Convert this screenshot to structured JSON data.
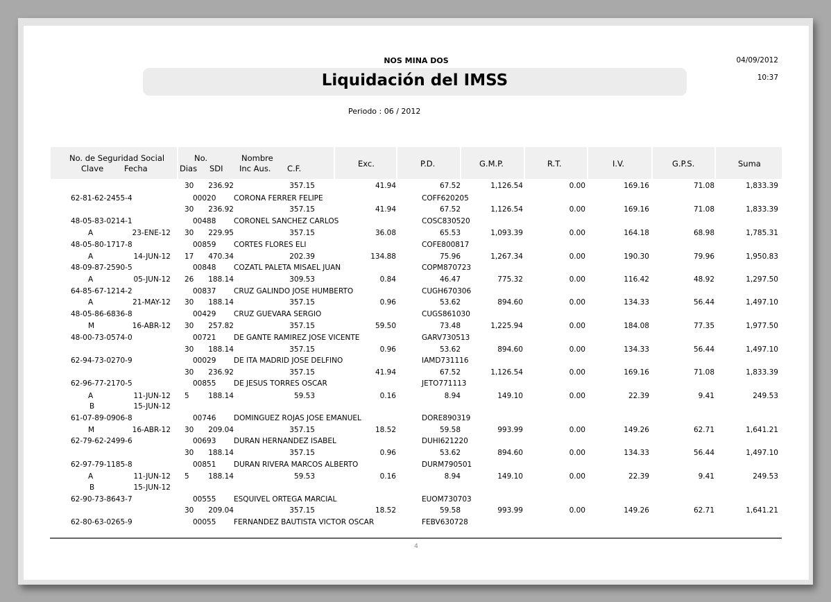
{
  "company": "NOS MINA DOS",
  "title": "Liquidación del IMSS",
  "date": "04/09/2012",
  "time": "10:37",
  "periodo": "Periodo :  06 / 2012",
  "headers": {
    "nss": "No. de Seguridad Social",
    "clave": "Clave",
    "fecha": "Fecha",
    "no": "No.",
    "dias": "Dias",
    "sdi": "SDI",
    "nombre": "Nombre",
    "inc_aus": "Inc Aus.",
    "cf": "C.F.",
    "exc": "Exc.",
    "pd": "P.D.",
    "gmp": "G.M.P.",
    "rt": "R.T.",
    "iv": "I.V.",
    "gps": "G.P.S.",
    "suma": "Suma"
  },
  "rows": [
    {
      "type": "amount",
      "clave": "",
      "fecha": "",
      "dias": "30",
      "sdi": "236.92",
      "cf": "357.15",
      "exc": "41.94",
      "pd": "67.52",
      "gmp": "1,126.54",
      "rt": "0.00",
      "iv": "169.16",
      "gps": "71.08",
      "suma": "1,833.39"
    },
    {
      "type": "emp",
      "nss": "62-81-62-2455-4",
      "no": "00020",
      "nombre": "CORONA FERRER FELIPE",
      "rfc": "COFF620205"
    },
    {
      "type": "amount",
      "clave": "",
      "fecha": "",
      "dias": "30",
      "sdi": "236.92",
      "cf": "357.15",
      "exc": "41.94",
      "pd": "67.52",
      "gmp": "1,126.54",
      "rt": "0.00",
      "iv": "169.16",
      "gps": "71.08",
      "suma": "1,833.39"
    },
    {
      "type": "emp",
      "nss": "48-05-83-0214-1",
      "no": "00488",
      "nombre": "CORONEL SANCHEZ CARLOS",
      "rfc": "COSC830520"
    },
    {
      "type": "amount",
      "clave": "A",
      "fecha": "23-ENE-12",
      "dias": "30",
      "sdi": "229.95",
      "cf": "357.15",
      "exc": "36.08",
      "pd": "65.53",
      "gmp": "1,093.39",
      "rt": "0.00",
      "iv": "164.18",
      "gps": "68.98",
      "suma": "1,785.31"
    },
    {
      "type": "emp",
      "nss": "48-05-80-1717-8",
      "no": "00859",
      "nombre": "CORTES FLORES ELI",
      "rfc": "COFE800817"
    },
    {
      "type": "amount",
      "clave": "A",
      "fecha": "14-JUN-12",
      "dias": "17",
      "sdi": "470.34",
      "cf": "202.39",
      "exc": "134.88",
      "pd": "75.96",
      "gmp": "1,267.34",
      "rt": "0.00",
      "iv": "190.30",
      "gps": "79.96",
      "suma": "1,950.83"
    },
    {
      "type": "emp",
      "nss": "48-09-87-2590-5",
      "no": "00848",
      "nombre": "COZATL PALETA MISAEL JUAN",
      "rfc": "COPM870723"
    },
    {
      "type": "amount",
      "clave": "A",
      "fecha": "05-JUN-12",
      "dias": "26",
      "sdi": "188.14",
      "cf": "309.53",
      "exc": "0.84",
      "pd": "46.47",
      "gmp": "775.32",
      "rt": "0.00",
      "iv": "116.42",
      "gps": "48.92",
      "suma": "1,297.50"
    },
    {
      "type": "emp",
      "nss": "64-85-67-1214-2",
      "no": "00837",
      "nombre": "CRUZ GALINDO JOSE HUMBERTO",
      "rfc": "CUGH670306"
    },
    {
      "type": "amount",
      "clave": "A",
      "fecha": "21-MAY-12",
      "dias": "30",
      "sdi": "188.14",
      "cf": "357.15",
      "exc": "0.96",
      "pd": "53.62",
      "gmp": "894.60",
      "rt": "0.00",
      "iv": "134.33",
      "gps": "56.44",
      "suma": "1,497.10"
    },
    {
      "type": "emp",
      "nss": "48-05-86-6836-8",
      "no": "00429",
      "nombre": "CRUZ GUEVARA SERGIO",
      "rfc": "CUGS861030"
    },
    {
      "type": "amount",
      "clave": "M",
      "fecha": "16-ABR-12",
      "dias": "30",
      "sdi": "257.82",
      "cf": "357.15",
      "exc": "59.50",
      "pd": "73.48",
      "gmp": "1,225.94",
      "rt": "0.00",
      "iv": "184.08",
      "gps": "77.35",
      "suma": "1,977.50"
    },
    {
      "type": "emp",
      "nss": "48-00-73-0574-0",
      "no": "00721",
      "nombre": "DE GANTE RAMIREZ JOSE VICENTE",
      "rfc": "GARV730513"
    },
    {
      "type": "amount",
      "clave": "",
      "fecha": "",
      "dias": "30",
      "sdi": "188.14",
      "cf": "357.15",
      "exc": "0.96",
      "pd": "53.62",
      "gmp": "894.60",
      "rt": "0.00",
      "iv": "134.33",
      "gps": "56.44",
      "suma": "1,497.10"
    },
    {
      "type": "emp",
      "nss": "62-94-73-0270-9",
      "no": "00029",
      "nombre": "DE ITA MADRID JOSE DELFINO",
      "rfc": "IAMD731116"
    },
    {
      "type": "amount",
      "clave": "",
      "fecha": "",
      "dias": "30",
      "sdi": "236.92",
      "cf": "357.15",
      "exc": "41.94",
      "pd": "67.52",
      "gmp": "1,126.54",
      "rt": "0.00",
      "iv": "169.16",
      "gps": "71.08",
      "suma": "1,833.39"
    },
    {
      "type": "emp",
      "nss": "62-96-77-2170-5",
      "no": "00855",
      "nombre": "DE JESUS TORRES OSCAR",
      "rfc": "JETO771113"
    },
    {
      "type": "amount",
      "clave": "A",
      "fecha": "11-JUN-12",
      "dias": "5",
      "sdi": "188.14",
      "cf": "59.53",
      "exc": "0.16",
      "pd": "8.94",
      "gmp": "149.10",
      "rt": "0.00",
      "iv": "22.39",
      "gps": "9.41",
      "suma": "249.53"
    },
    {
      "type": "inc",
      "clave": "B",
      "fecha": "15-JUN-12"
    },
    {
      "type": "emp",
      "nss": "61-07-89-0906-8",
      "no": "00746",
      "nombre": "DOMINGUEZ ROJAS JOSE EMANUEL",
      "rfc": "DORE890319"
    },
    {
      "type": "amount",
      "clave": "M",
      "fecha": "16-ABR-12",
      "dias": "30",
      "sdi": "209.04",
      "cf": "357.15",
      "exc": "18.52",
      "pd": "59.58",
      "gmp": "993.99",
      "rt": "0.00",
      "iv": "149.26",
      "gps": "62.71",
      "suma": "1,641.21"
    },
    {
      "type": "emp",
      "nss": "62-79-62-2499-6",
      "no": "00693",
      "nombre": "DURAN HERNANDEZ ISABEL",
      "rfc": "DUHI621220"
    },
    {
      "type": "amount",
      "clave": "",
      "fecha": "",
      "dias": "30",
      "sdi": "188.14",
      "cf": "357.15",
      "exc": "0.96",
      "pd": "53.62",
      "gmp": "894.60",
      "rt": "0.00",
      "iv": "134.33",
      "gps": "56.44",
      "suma": "1,497.10"
    },
    {
      "type": "emp",
      "nss": "62-97-79-1185-8",
      "no": "00851",
      "nombre": "DURAN RIVERA MARCOS ALBERTO",
      "rfc": "DURM790501"
    },
    {
      "type": "amount",
      "clave": "A",
      "fecha": "11-JUN-12",
      "dias": "5",
      "sdi": "188.14",
      "cf": "59.53",
      "exc": "0.16",
      "pd": "8.94",
      "gmp": "149.10",
      "rt": "0.00",
      "iv": "22.39",
      "gps": "9.41",
      "suma": "249.53"
    },
    {
      "type": "inc",
      "clave": "B",
      "fecha": "15-JUN-12"
    },
    {
      "type": "emp",
      "nss": "62-90-73-8643-7",
      "no": "00555",
      "nombre": "ESQUIVEL ORTEGA MARCIAL",
      "rfc": "EUOM730703"
    },
    {
      "type": "amount",
      "clave": "",
      "fecha": "",
      "dias": "30",
      "sdi": "209.04",
      "cf": "357.15",
      "exc": "18.52",
      "pd": "59.58",
      "gmp": "993.99",
      "rt": "0.00",
      "iv": "149.26",
      "gps": "62.71",
      "suma": "1,641.21"
    },
    {
      "type": "emp",
      "nss": "62-80-63-0265-9",
      "no": "00055",
      "nombre": "FERNANDEZ BAUTISTA VICTOR OSCAR",
      "rfc": "FEBV630728"
    }
  ],
  "page_number": "4"
}
